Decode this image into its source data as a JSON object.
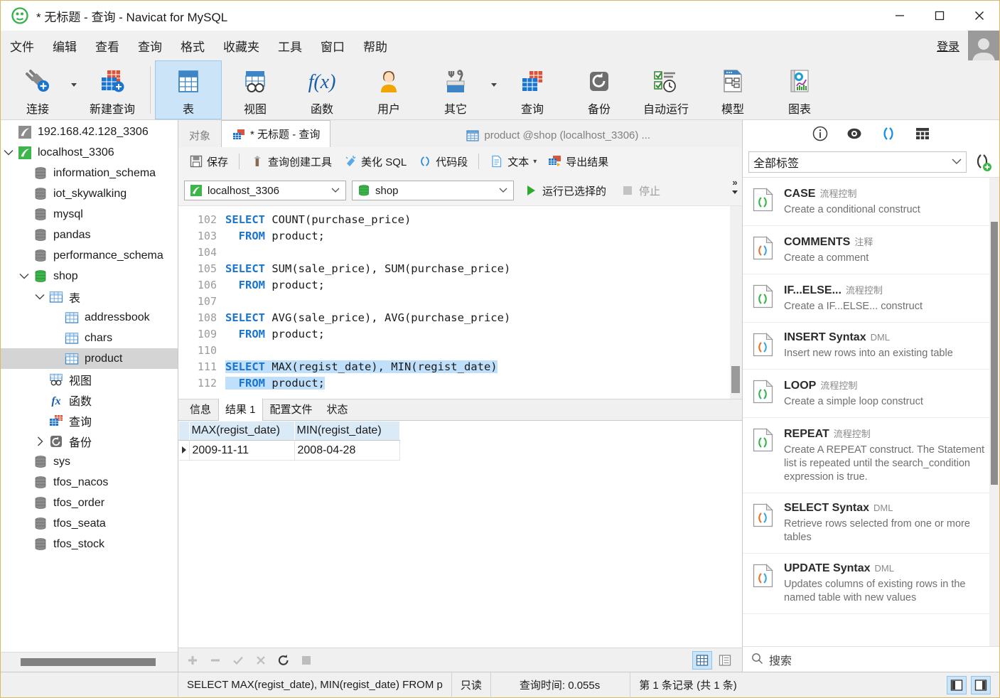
{
  "window": {
    "title": "* 无标题 - 查询 - Navicat for MySQL",
    "minimize_label": "最小化",
    "maximize_label": "最大化",
    "close_label": "关闭"
  },
  "menubar": {
    "items": [
      "文件",
      "编辑",
      "查看",
      "查询",
      "格式",
      "收藏夹",
      "工具",
      "窗口",
      "帮助"
    ],
    "login_label": "登录"
  },
  "ribbon": {
    "items": [
      {
        "label": "连接",
        "icon": "connection-icon",
        "has_caret": true
      },
      {
        "label": "新建查询",
        "icon": "new-query-icon",
        "has_caret": false
      },
      {
        "label": "表",
        "icon": "table-icon",
        "active": true
      },
      {
        "label": "视图",
        "icon": "view-icon"
      },
      {
        "label": "函数",
        "icon": "function-icon"
      },
      {
        "label": "用户",
        "icon": "user-icon"
      },
      {
        "label": "其它",
        "icon": "other-icon",
        "has_caret": true
      },
      {
        "label": "查询",
        "icon": "query-icon"
      },
      {
        "label": "备份",
        "icon": "backup-icon"
      },
      {
        "label": "自动运行",
        "icon": "automation-icon"
      },
      {
        "label": "模型",
        "icon": "model-icon"
      },
      {
        "label": "图表",
        "icon": "chart-icon"
      }
    ]
  },
  "sidebar": {
    "items": [
      {
        "label": "192.168.42.128_3306",
        "indent": 1,
        "icon": "connection-grey-icon",
        "twist": "none"
      },
      {
        "label": "localhost_3306",
        "indent": 1,
        "icon": "connection-green-icon",
        "twist": "open"
      },
      {
        "label": "information_schema",
        "indent": 2,
        "icon": "database-grey-icon",
        "twist": "none"
      },
      {
        "label": "iot_skywalking",
        "indent": 2,
        "icon": "database-grey-icon",
        "twist": "none"
      },
      {
        "label": "mysql",
        "indent": 2,
        "icon": "database-grey-icon",
        "twist": "none"
      },
      {
        "label": "pandas",
        "indent": 2,
        "icon": "database-grey-icon",
        "twist": "none"
      },
      {
        "label": "performance_schema",
        "indent": 2,
        "icon": "database-grey-icon",
        "twist": "none"
      },
      {
        "label": "shop",
        "indent": 2,
        "icon": "database-green-icon",
        "twist": "open"
      },
      {
        "label": "表",
        "indent": 3,
        "icon": "table-folder-icon",
        "twist": "open"
      },
      {
        "label": "addressbook",
        "indent": 4,
        "icon": "table-icon",
        "twist": "none"
      },
      {
        "label": "chars",
        "indent": 4,
        "icon": "table-icon",
        "twist": "none"
      },
      {
        "label": "product",
        "indent": 4,
        "icon": "table-icon",
        "twist": "none",
        "selected": true
      },
      {
        "label": "视图",
        "indent": 3,
        "icon": "view-icon",
        "twist": "none"
      },
      {
        "label": "函数",
        "indent": 3,
        "icon": "function-icon",
        "twist": "none"
      },
      {
        "label": "查询",
        "indent": 3,
        "icon": "query-icon",
        "twist": "none"
      },
      {
        "label": "备份",
        "indent": 3,
        "icon": "backup-icon",
        "twist": "closed"
      },
      {
        "label": "sys",
        "indent": 2,
        "icon": "database-grey-icon",
        "twist": "none"
      },
      {
        "label": "tfos_nacos",
        "indent": 2,
        "icon": "database-grey-icon",
        "twist": "none"
      },
      {
        "label": "tfos_order",
        "indent": 2,
        "icon": "database-grey-icon",
        "twist": "none"
      },
      {
        "label": "tfos_seata",
        "indent": 2,
        "icon": "database-grey-icon",
        "twist": "none"
      },
      {
        "label": "tfos_stock",
        "indent": 2,
        "icon": "database-grey-icon",
        "twist": "none"
      }
    ]
  },
  "tabs": {
    "objects_label": "对象",
    "query_tab_label": "* 无标题 - 查询",
    "table_tab_label": "product @shop (localhost_3306) ..."
  },
  "query_toolbar": {
    "save": "保存",
    "query_builder": "查询创建工具",
    "beautify": "美化 SQL",
    "snippet": "代码段",
    "text": "文本",
    "export": "导出结果",
    "more": "»"
  },
  "connection_bar": {
    "connection": "localhost_3306",
    "database": "shop",
    "run_selected": "运行已选择的",
    "stop": "停止"
  },
  "editor": {
    "first_line_number": 102,
    "lines": [
      {
        "n": 102,
        "segments": [
          {
            "t": "SELECT",
            "kw": true
          },
          {
            "t": " COUNT(purchase_price)"
          }
        ]
      },
      {
        "n": 103,
        "segments": [
          {
            "t": "  "
          },
          {
            "t": "FROM",
            "kw": true
          },
          {
            "t": " product;"
          }
        ]
      },
      {
        "n": 104,
        "segments": [
          {
            "t": ""
          }
        ]
      },
      {
        "n": 105,
        "segments": [
          {
            "t": "SELECT",
            "kw": true
          },
          {
            "t": " SUM(sale_price), SUM(purchase_price)"
          }
        ]
      },
      {
        "n": 106,
        "segments": [
          {
            "t": "  "
          },
          {
            "t": "FROM",
            "kw": true
          },
          {
            "t": " product;"
          }
        ]
      },
      {
        "n": 107,
        "segments": [
          {
            "t": ""
          }
        ]
      },
      {
        "n": 108,
        "segments": [
          {
            "t": "SELECT",
            "kw": true
          },
          {
            "t": " AVG(sale_price), AVG(purchase_price)"
          }
        ]
      },
      {
        "n": 109,
        "segments": [
          {
            "t": "  "
          },
          {
            "t": "FROM",
            "kw": true
          },
          {
            "t": " product;"
          }
        ]
      },
      {
        "n": 110,
        "segments": [
          {
            "t": ""
          }
        ]
      },
      {
        "n": 111,
        "highlight": true,
        "caret": true,
        "segments": [
          {
            "t": "SELECT",
            "kw": true
          },
          {
            "t": " MAX(regist_date), MIN(regist_date)"
          }
        ]
      },
      {
        "n": 112,
        "highlight": true,
        "segments": [
          {
            "t": "  "
          },
          {
            "t": "FROM",
            "kw": true
          },
          {
            "t": " product;"
          }
        ]
      }
    ]
  },
  "results": {
    "tabs": [
      "信息",
      "结果 1",
      "配置文件",
      "状态"
    ],
    "active_tab": "结果 1",
    "columns": [
      "MAX(regist_date)",
      "MIN(regist_date)"
    ],
    "rows": [
      [
        "2009-11-11",
        "2008-04-28"
      ]
    ],
    "grid_view_label": "网格查看",
    "form_view_label": "表单查看"
  },
  "right_panel": {
    "top_icons": [
      "info-icon",
      "eye-icon",
      "snippet-icon",
      "grid-icon"
    ],
    "filter_value": "全部标签",
    "add_label": "添加代码段",
    "search_placeholder": "搜索",
    "snippets": [
      {
        "title": "CASE",
        "category": "流程控制",
        "desc": "Create a conditional construct",
        "icon_color": "green"
      },
      {
        "title": "COMMENTS",
        "category": "注释",
        "desc": "Create a comment",
        "icon_color": "orange"
      },
      {
        "title": "IF...ELSE...",
        "category": "流程控制",
        "desc": "Create a IF...ELSE... construct",
        "icon_color": "green"
      },
      {
        "title": "INSERT Syntax",
        "category": "DML",
        "desc": "Insert new rows into an existing table",
        "icon_color": "orange"
      },
      {
        "title": "LOOP",
        "category": "流程控制",
        "desc": "Create a simple loop construct",
        "icon_color": "green"
      },
      {
        "title": "REPEAT",
        "category": "流程控制",
        "desc": "Create A REPEAT construct. The Statement list is repeated until the search_condition expression is true.",
        "icon_color": "green"
      },
      {
        "title": "SELECT Syntax",
        "category": "DML",
        "desc": "Retrieve rows selected from one or more tables",
        "icon_color": "orange"
      },
      {
        "title": "UPDATE Syntax",
        "category": "DML",
        "desc": "Updates columns of existing rows in the named table with new values",
        "icon_color": "orange"
      }
    ]
  },
  "statusbar": {
    "sql": "SELECT MAX(regist_date), MIN(regist_date)  FROM p",
    "readonly": "只读",
    "query_time": "查询时间: 0.055s",
    "record_info": "第 1 条记录 (共 1 条)"
  },
  "colors": {
    "accent_blue": "#1a75cf",
    "selection": "#bfdffb",
    "header_blue": "#dbeaf7",
    "green": "#36a936",
    "orange": "#e8722a"
  }
}
